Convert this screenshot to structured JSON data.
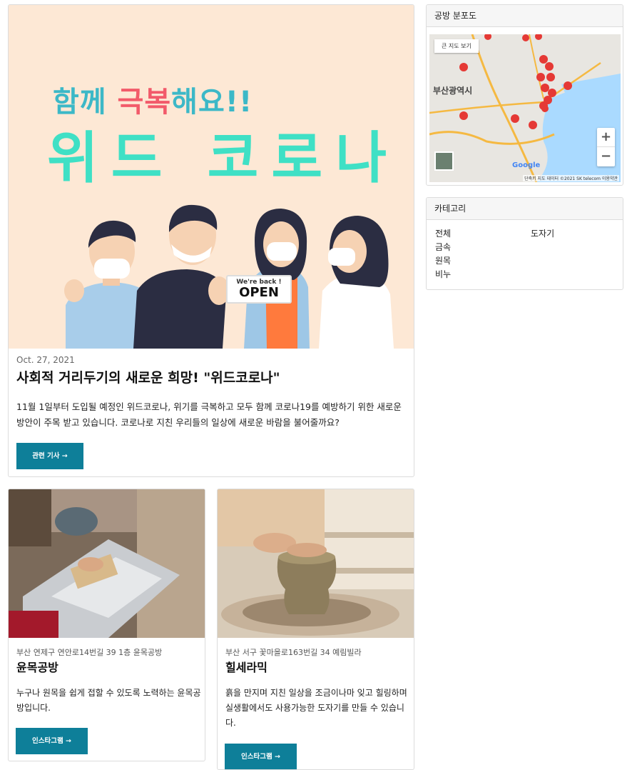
{
  "main_post": {
    "hero_line1_a": "함께 ",
    "hero_line1_accent": "극복",
    "hero_line1_b": "해요!!",
    "hero_line2": "위드 코로나",
    "sign_small": "We're back !",
    "sign_big": "OPEN",
    "date": "Oct. 27, 2021",
    "title": "사회적 거리두기의 새로운 희망! \"위드코로나\"",
    "description": "11월 1일부터 도입될 예정인 위드코로나, 위기를 극복하고 모두 함께 코로나19를 예방하기 위한 새로운 방안이 주목 받고 있습니다. 코로나로 지친 우리들의 일상에 새로운 바람을 불어줄까요?",
    "button": "관련 기사 →"
  },
  "posts": [
    {
      "address": "부산 연제구 연안로14번길 39 1층 윤목공방",
      "title": "윤목공방",
      "description": "누구나 원목을 쉽게 접할 수 있도록 노력하는 윤목공방입니다.",
      "button": "인스타그램 →"
    },
    {
      "address": "부산 서구 꽃마을로163번길 34 예림빌라",
      "title": "힐세라믹",
      "description": "흙을 만지며 지친 일상을 조금이나마 잊고 힐링하며 실생활에서도 사용가능한 도자기를 만들 수 있습니다.",
      "button": "인스타그램 →"
    }
  ],
  "sidebar": {
    "map_title": "공방 분포도",
    "map_button": "큰 지도 보기",
    "map_place": "부산광역시",
    "map_attribution": "단축키 지도 데이터 ©2021 SK telecom 이용약관",
    "map_logo": "Google",
    "zoom_in": "+",
    "zoom_out": "−",
    "category_title": "카테고리",
    "categories_col1": [
      "전체",
      "금속",
      "원목",
      "비누"
    ],
    "categories_col2": [
      "도자기"
    ]
  },
  "colors": {
    "accent_button": "#0e7f99",
    "hero_bg": "#fde8d5",
    "hero_teal": "#3cb8c7",
    "hero_mint": "#3fe0c5",
    "hero_pink": "#f25a6a"
  }
}
